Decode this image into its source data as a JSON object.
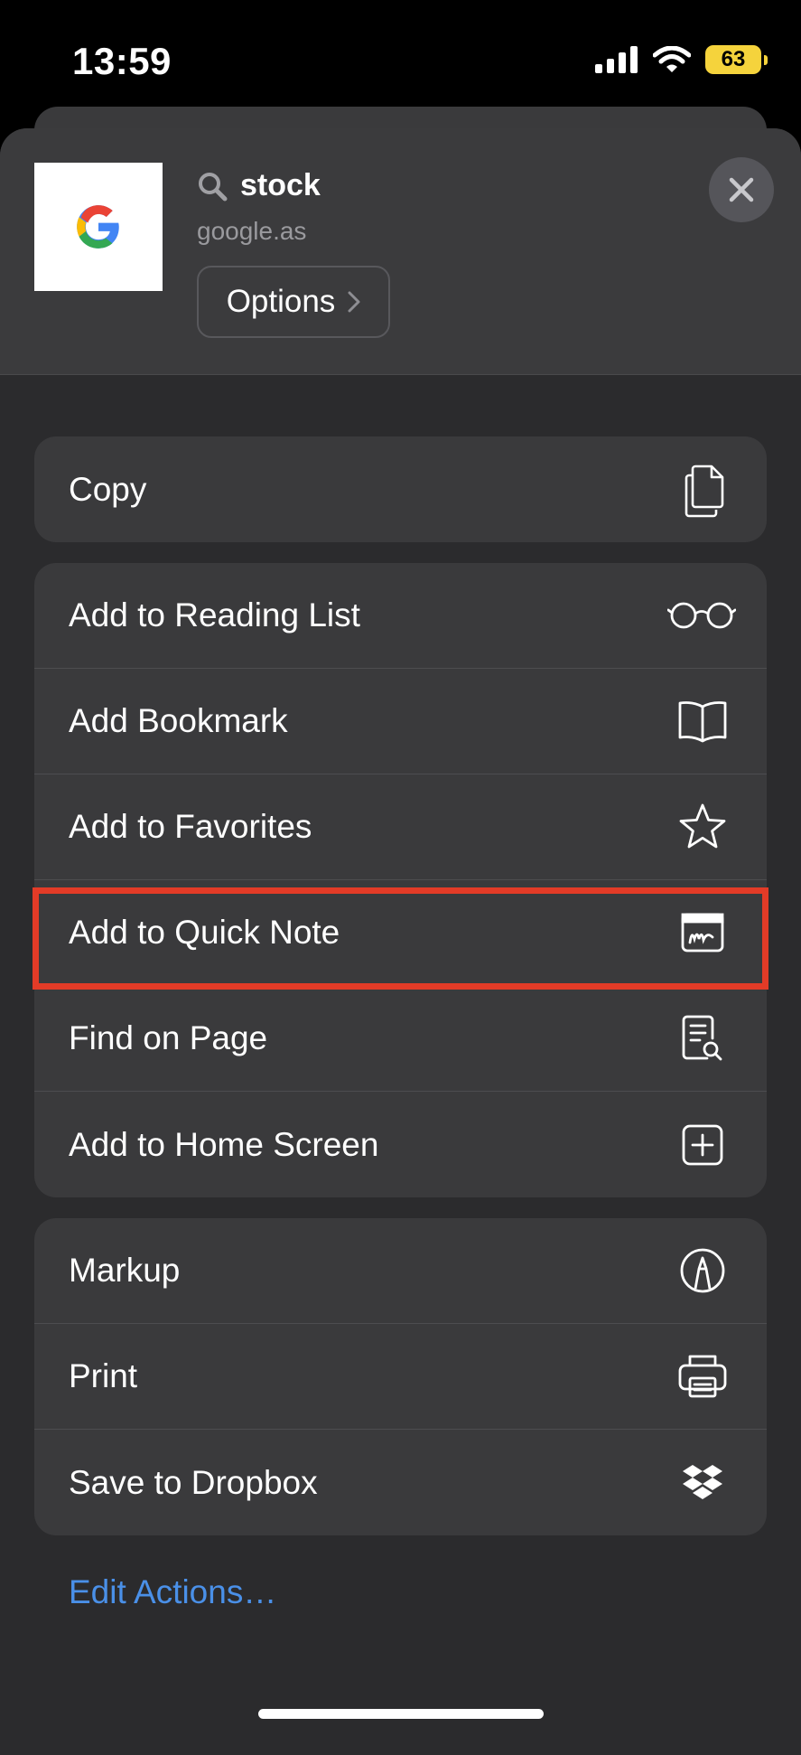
{
  "status_bar": {
    "time": "13:59",
    "battery": "63",
    "battery_color": "#f5d33c"
  },
  "header": {
    "title": "stock",
    "subtitle": "google.as",
    "options_label": "Options",
    "thumbnail_icon": "google-g-logo"
  },
  "groups": {
    "copy": [
      {
        "label": "Copy",
        "icon": "copy-icon"
      }
    ],
    "page_actions": [
      {
        "label": "Add to Reading List",
        "icon": "glasses-icon"
      },
      {
        "label": "Add Bookmark",
        "icon": "book-icon"
      },
      {
        "label": "Add to Favorites",
        "icon": "star-icon"
      },
      {
        "label": "Add to Quick Note",
        "icon": "quick-note-icon"
      },
      {
        "label": "Find on Page",
        "icon": "find-page-icon"
      },
      {
        "label": "Add to Home Screen",
        "icon": "plus-square-icon"
      }
    ],
    "extensions": [
      {
        "label": "Markup",
        "icon": "markup-pen-icon"
      },
      {
        "label": "Print",
        "icon": "printer-icon"
      },
      {
        "label": "Save to Dropbox",
        "icon": "dropbox-icon"
      }
    ]
  },
  "footer": {
    "edit_actions": "Edit Actions…",
    "link_color": "#4a90e8"
  },
  "highlight_color": "#e33b27"
}
